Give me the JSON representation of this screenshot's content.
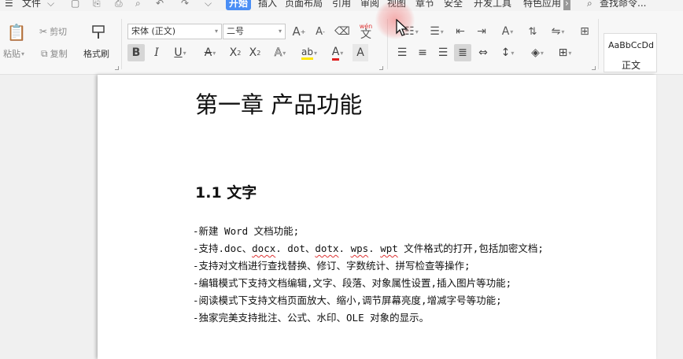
{
  "menu": {
    "file": "文件",
    "tabs": [
      "开始",
      "插入",
      "页面布局",
      "引用",
      "审阅",
      "视图",
      "章节",
      "安全",
      "开发工具",
      "特色应用"
    ],
    "search": "查找命令..."
  },
  "clipboard": {
    "paste": "粘贴",
    "cut": "剪切",
    "copy": "复制",
    "format_painter": "格式刷"
  },
  "font": {
    "family": "宋体 (正文)",
    "size": "二号",
    "pinyin": "wén"
  },
  "styles": {
    "sample": "AaBbCcDd",
    "name": "正文"
  },
  "document": {
    "title": "第一章 产品功能",
    "section": "1.1 文字",
    "lines": [
      "-新建 Word 文档功能;",
      [
        "-支持.doc、",
        [
          "docx",
          "."
        ],
        " dot、",
        [
          "dotx",
          "."
        ],
        " ",
        [
          "wps",
          "."
        ],
        " ",
        [
          "wpt",
          ""
        ],
        " 文件格式的打开,包括加密文档;"
      ],
      "-支持对文档进行查找替换、修订、字数统计、拼写检查等操作;",
      "-编辑模式下支持文档编辑,文字、段落、对象属性设置,插入图片等功能;",
      "-阅读模式下支持文档页面放大、缩小,调节屏幕亮度,增减字号等功能;",
      "-独家完美支持批注、公式、水印、OLE 对象的显示。"
    ]
  },
  "colors": {
    "active_tab": "#4a8ef5",
    "font_color": "#e02020",
    "highlight": "#ffe600",
    "spell_squiggle": "#d33"
  }
}
